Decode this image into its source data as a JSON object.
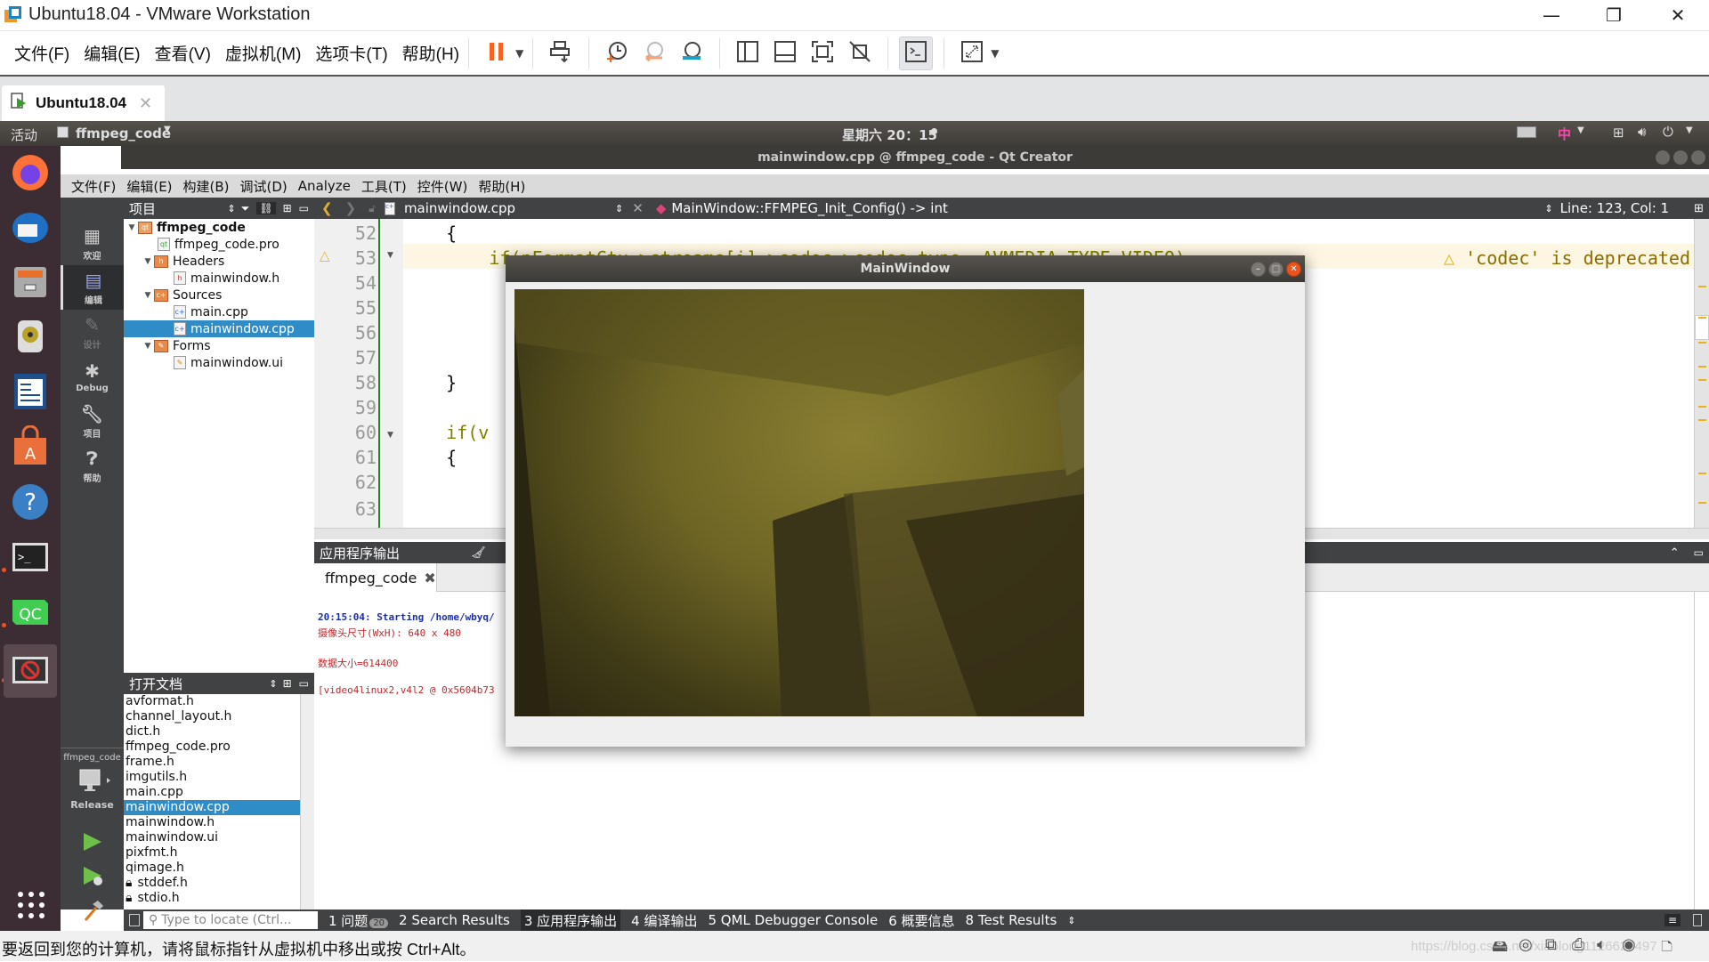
{
  "vmware": {
    "title": "Ubuntu18.04 - VMware Workstation",
    "menus": [
      "文件(F)",
      "编辑(E)",
      "查看(V)",
      "虚拟机(M)",
      "选项卡(T)",
      "帮助(H)"
    ],
    "toolbar_icons": [
      "pause-icon",
      "dropdown-icon",
      "send-ctrl-alt-del-icon",
      "snapshot-take-icon",
      "snapshot-revert-icon",
      "snapshot-manager-icon",
      "show-library-icon",
      "show-thumbnail-icon",
      "fullscreen-icon",
      "unity-icon",
      "console-view-icon",
      "stretch-guest-icon"
    ],
    "tab_label": "Ubuntu18.04",
    "status_message": "要返回到您的计算机，请将鼠标指针从虚拟机中移出或按 Ctrl+Alt。",
    "watermark": "https://blog.csdn.net/xiaolong1126626497"
  },
  "ubuntu": {
    "activities": "活动",
    "app_menu": "ffmpeg_code",
    "clock": "星期六 20：15",
    "input_method": "中"
  },
  "qtcreator": {
    "window_title": "mainwindow.cpp @ ffmpeg_code - Qt Creator",
    "menus": [
      "文件(F)",
      "编辑(E)",
      "构建(B)",
      "调试(D)",
      "Analyze",
      "工具(T)",
      "控件(W)",
      "帮助(H)"
    ],
    "modes": [
      {
        "label": "欢迎",
        "icon": "welcome-grid-icon"
      },
      {
        "label": "编辑",
        "icon": "edit-icon",
        "active": true
      },
      {
        "label": "设计",
        "icon": "design-pencil-icon"
      },
      {
        "label": "Debug",
        "icon": "debug-bug-icon"
      },
      {
        "label": "项目",
        "icon": "projects-wrench-icon"
      },
      {
        "label": "帮助",
        "icon": "help-icon"
      }
    ],
    "kit": {
      "project": "ffmpeg_code",
      "build": "Release"
    },
    "project_pane": {
      "title": "项目",
      "tree": [
        {
          "label": "ffmpeg_code",
          "level": 0,
          "type": "project",
          "expanded": true
        },
        {
          "label": "ffmpeg_code.pro",
          "level": 1,
          "type": "pro"
        },
        {
          "label": "Headers",
          "level": 1,
          "type": "folder-h",
          "expanded": true
        },
        {
          "label": "mainwindow.h",
          "level": 2,
          "type": "h"
        },
        {
          "label": "Sources",
          "level": 1,
          "type": "folder-cpp",
          "expanded": true
        },
        {
          "label": "main.cpp",
          "level": 2,
          "type": "cpp"
        },
        {
          "label": "mainwindow.cpp",
          "level": 2,
          "type": "cpp",
          "selected": true
        },
        {
          "label": "Forms",
          "level": 1,
          "type": "folder-ui",
          "expanded": true
        },
        {
          "label": "mainwindow.ui",
          "level": 2,
          "type": "ui"
        }
      ]
    },
    "open_documents": {
      "title": "打开文档",
      "items": [
        "avformat.h",
        "channel_layout.h",
        "dict.h",
        "ffmpeg_code.pro",
        "frame.h",
        "imgutils.h",
        "main.cpp",
        "mainwindow.cpp",
        "mainwindow.h",
        "mainwindow.ui",
        "pixfmt.h",
        "qimage.h",
        "stddef.h",
        "stdio.h"
      ],
      "selected": "mainwindow.cpp",
      "locked": [
        "stddef.h",
        "stdio.h"
      ]
    },
    "editor": {
      "file": "mainwindow.cpp",
      "symbol": "MainWindow::FFMPEG_Init_Config() -> int",
      "cursor": "Line: 123, Col: 1",
      "warning": "'codec' is deprecated",
      "lines": [
        {
          "n": "52",
          "text": "    {"
        },
        {
          "n": "53",
          "text": "        if(pFormatCtx->streams[i]->codec->codec_type==AVMEDIA_TYPE_VIDEO)",
          "warn": true
        },
        {
          "n": "54",
          "text": ""
        },
        {
          "n": "55",
          "text": ""
        },
        {
          "n": "56",
          "text": ""
        },
        {
          "n": "57",
          "text": ""
        },
        {
          "n": "58",
          "text": "    }"
        },
        {
          "n": "59",
          "text": ""
        },
        {
          "n": "60",
          "text": "    if(v"
        },
        {
          "n": "61",
          "text": "    {"
        },
        {
          "n": "62",
          "text": ""
        },
        {
          "n": "63",
          "text": ""
        }
      ]
    },
    "output": {
      "title": "应用程序输出",
      "tab": "ffmpeg_code",
      "lines": [
        {
          "text": "20:15:04: Starting /home/wbyq/",
          "kind": "start"
        },
        {
          "text": "摄像头尺寸(WxH): 640 x 480",
          "kind": "stderr"
        },
        {
          "text": "",
          "kind": "blank"
        },
        {
          "text": "数据大小=614400",
          "kind": "stderr"
        },
        {
          "text": "",
          "kind": "blank"
        },
        {
          "text": "[video4linux2,v4l2 @ 0x5604b73",
          "kind": "info"
        }
      ]
    },
    "bottom_bar": {
      "locator_placeholder": "Type to locate (Ctrl...",
      "panes": [
        {
          "label": "1 问题",
          "badge": "20"
        },
        {
          "label": "2 Search Results"
        },
        {
          "label": "3 应用程序输出",
          "active": true
        },
        {
          "label": "4 编译输出"
        },
        {
          "label": "5 QML Debugger Console"
        },
        {
          "label": "6 概要信息"
        },
        {
          "label": "8 Test Results"
        }
      ]
    }
  },
  "mainwindow": {
    "title": "MainWindow",
    "video_resolution": "640 x 480"
  },
  "dock": [
    "firefox-icon",
    "thunderbird-icon",
    "files-icon",
    "rhythmbox-icon",
    "libreoffice-writer-icon",
    "software-center-icon",
    "help-icon",
    "terminal-icon",
    "qtcreator-icon",
    "mainwindow-app-icon"
  ]
}
